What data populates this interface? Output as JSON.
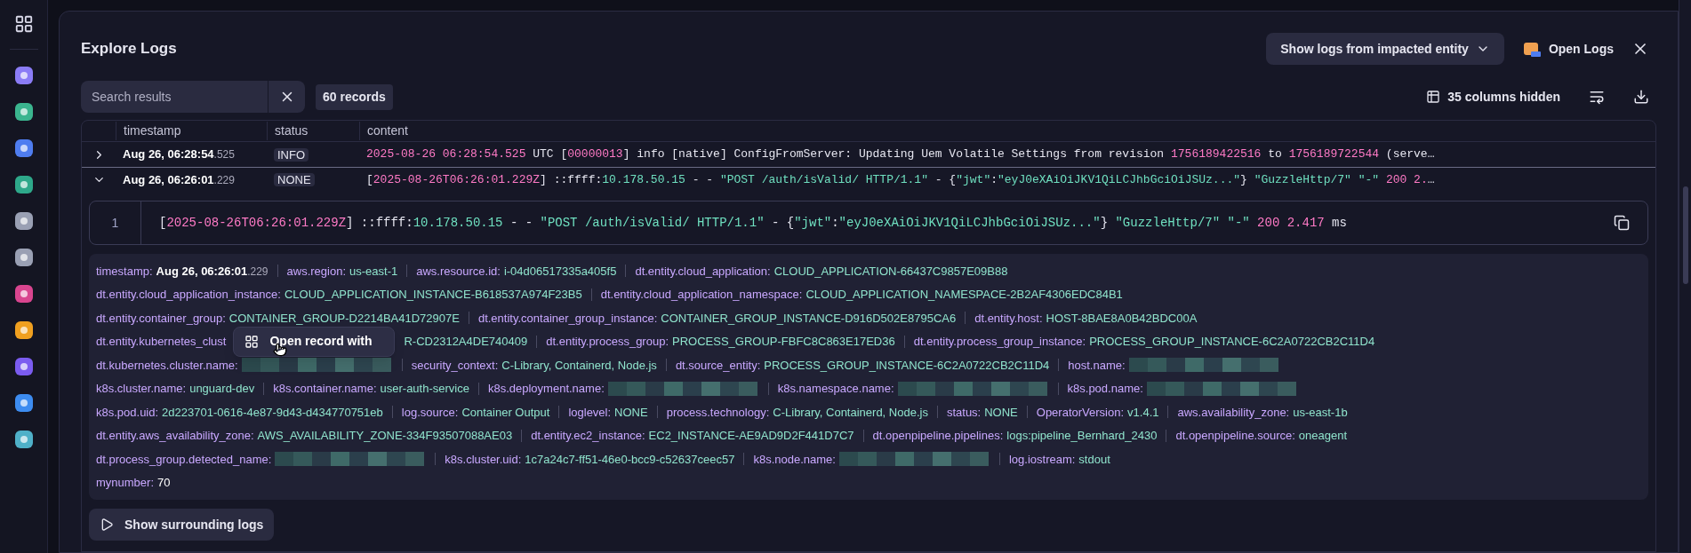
{
  "title": "Explore Logs",
  "entity_dropdown": "Show logs from impacted entity",
  "open_logs": "Open Logs",
  "search": {
    "placeholder": "Search results"
  },
  "record_count": "60 records",
  "columns_hidden": "35 columns hidden",
  "table": {
    "columns": [
      "timestamp",
      "status",
      "content"
    ],
    "rows": [
      {
        "expanded": false,
        "time": "Aug 26, 06:28:54",
        "ms": ".525",
        "status": "INFO",
        "content": [
          {
            "text": "2025-08-26 06:28:54.525",
            "kind": "num"
          },
          {
            "text": " UTC [",
            "kind": "plain"
          },
          {
            "text": "00000013",
            "kind": "num"
          },
          {
            "text": "] info [native] ConfigFromServer: Updating Uem Volatile Settings from revision ",
            "kind": "plain"
          },
          {
            "text": "1756189422516",
            "kind": "num"
          },
          {
            "text": " to ",
            "kind": "plain"
          },
          {
            "text": "1756189722544",
            "kind": "num"
          },
          {
            "text": " (serve…",
            "kind": "plain"
          }
        ]
      },
      {
        "expanded": true,
        "time": "Aug 26, 06:26:01",
        "ms": ".229",
        "status": "NONE",
        "content": [
          {
            "text": "[",
            "kind": "plain"
          },
          {
            "text": "2025-08-26T06:26:01.229Z",
            "kind": "num"
          },
          {
            "text": "] ::ffff:",
            "kind": "plain"
          },
          {
            "text": "10.178.50.15",
            "kind": "str"
          },
          {
            "text": " - - ",
            "kind": "plain"
          },
          {
            "text": "\"POST /auth/isValid/ HTTP/1.1\"",
            "kind": "str"
          },
          {
            "text": " - {",
            "kind": "plain"
          },
          {
            "text": "\"jwt\"",
            "kind": "str"
          },
          {
            "text": ":",
            "kind": "plain"
          },
          {
            "text": "\"eyJ0eXAiOiJKV1QiLCJhbGciOiJSUz...\"",
            "kind": "str"
          },
          {
            "text": "} ",
            "kind": "plain"
          },
          {
            "text": "\"GuzzleHttp/7\"",
            "kind": "str"
          },
          {
            "text": " \"-\"",
            "kind": "str"
          },
          {
            "text": " 200 2.",
            "kind": "num"
          },
          {
            "text": "…",
            "kind": "plain"
          }
        ]
      }
    ]
  },
  "detail": {
    "line_number": "1",
    "content": [
      {
        "text": "[",
        "kind": "plain"
      },
      {
        "text": "2025-08-26T06:26:01.229Z",
        "kind": "num"
      },
      {
        "text": "] ::ffff:",
        "kind": "plain"
      },
      {
        "text": "10.178.50.15",
        "kind": "str"
      },
      {
        "text": " - - ",
        "kind": "plain"
      },
      {
        "text": "\"POST /auth/isValid/ HTTP/1.1\"",
        "kind": "str"
      },
      {
        "text": " - {",
        "kind": "plain"
      },
      {
        "text": "\"jwt\"",
        "kind": "str"
      },
      {
        "text": ":",
        "kind": "plain"
      },
      {
        "text": "\"eyJ0eXAiOiJKV1QiLCJhbGciOiJSUz...\"",
        "kind": "str"
      },
      {
        "text": "} ",
        "kind": "plain"
      },
      {
        "text": "\"GuzzleHttp/7\"",
        "kind": "str"
      },
      {
        "text": " \"-\"",
        "kind": "str"
      },
      {
        "text": " 200 2.417",
        "kind": "num"
      },
      {
        "text": " ms",
        "kind": "plain"
      }
    ]
  },
  "popup": {
    "label": "Open record with"
  },
  "attributes": [
    [
      {
        "kind": "time",
        "key": "timestamp:",
        "value": "Aug 26, 06:26:01",
        "ms": ".229"
      },
      {
        "kind": "text",
        "key": "aws.region:",
        "value": "us-east-1"
      },
      {
        "kind": "text",
        "key": "aws.resource.id:",
        "value": "i-04d06517335a405f5"
      },
      {
        "kind": "text",
        "key": "dt.entity.cloud_application:",
        "value": "CLOUD_APPLICATION-66437C9857E09B88"
      }
    ],
    [
      {
        "kind": "text",
        "key": "dt.entity.cloud_application_instance:",
        "value": "CLOUD_APPLICATION_INSTANCE-B618537A974F23B5"
      },
      {
        "kind": "text",
        "key": "dt.entity.cloud_application_namespace:",
        "value": "CLOUD_APPLICATION_NAMESPACE-2B2AF4306EDC84B1"
      }
    ],
    [
      {
        "kind": "text",
        "key": "dt.entity.container_group:",
        "value": "CONTAINER_GROUP-D2214BA41D72907E"
      },
      {
        "kind": "text",
        "key": "dt.entity.container_group_instance:",
        "value": "CONTAINER_GROUP_INSTANCE-D916D502E8795CA6"
      },
      {
        "kind": "text",
        "key": "dt.entity.host:",
        "value": "HOST-8BAE8A0B42BDC00A"
      }
    ],
    [
      {
        "kind": "covered",
        "key": "dt.entity.kubernetes_clust",
        "value": "R-CD2312A4DE740409"
      },
      {
        "kind": "text",
        "key": "dt.entity.process_group:",
        "value": "PROCESS_GROUP-FBFC8C863E17ED36"
      },
      {
        "kind": "text",
        "key": "dt.entity.process_group_instance:",
        "value": "PROCESS_GROUP_INSTANCE-6C2A0722CB2C11D4"
      }
    ],
    [
      {
        "kind": "redacted",
        "key": "dt.kubernetes.cluster.name:"
      },
      {
        "kind": "text",
        "key": "security_context:",
        "value": "C-Library, Containerd, Node.js"
      },
      {
        "kind": "text",
        "key": "dt.source_entity:",
        "value": "PROCESS_GROUP_INSTANCE-6C2A0722CB2C11D4"
      },
      {
        "kind": "redacted",
        "key": "host.name:"
      }
    ],
    [
      {
        "kind": "text",
        "key": "k8s.cluster.name:",
        "value": "unguard-dev"
      },
      {
        "kind": "text",
        "key": "k8s.container.name:",
        "value": "user-auth-service"
      },
      {
        "kind": "redacted",
        "key": "k8s.deployment.name:"
      },
      {
        "kind": "redacted",
        "key": "k8s.namespace.name:"
      },
      {
        "kind": "redacted",
        "key": "k8s.pod.name:"
      }
    ],
    [
      {
        "kind": "text",
        "key": "k8s.pod.uid:",
        "value": "2d223701-0616-4e87-9d43-d434770751eb"
      },
      {
        "kind": "text",
        "key": "log.source:",
        "value": "Container Output"
      },
      {
        "kind": "text",
        "key": "loglevel:",
        "value": "NONE"
      },
      {
        "kind": "text",
        "key": "process.technology:",
        "value": "C-Library, Containerd, Node.js"
      },
      {
        "kind": "text",
        "key": "status:",
        "value": "NONE"
      },
      {
        "kind": "text",
        "key": "OperatorVersion:",
        "value": "v1.4.1"
      },
      {
        "kind": "text",
        "key": "aws.availability_zone:",
        "value": "us-east-1b"
      }
    ],
    [
      {
        "kind": "text",
        "key": "dt.entity.aws_availability_zone:",
        "value": "AWS_AVAILABILITY_ZONE-334F93507088AE03"
      },
      {
        "kind": "text",
        "key": "dt.entity.ec2_instance:",
        "value": "EC2_INSTANCE-AE9AD9D2F441D7C7"
      },
      {
        "kind": "text",
        "key": "dt.openpipeline.pipelines:",
        "value": "logs:pipeline_Bernhard_2430"
      },
      {
        "kind": "text",
        "key": "dt.openpipeline.source:",
        "value": "oneagent"
      }
    ],
    [
      {
        "kind": "redacted",
        "key": "dt.process_group.detected_name:"
      },
      {
        "kind": "text",
        "key": "k8s.cluster.uid:",
        "value": "1c7a24c7-ff51-46e0-bcc9-c52637ceec57"
      },
      {
        "kind": "redacted",
        "key": "k8s.node.name:"
      },
      {
        "kind": "text",
        "key": "log.iostream:",
        "value": "stdout"
      }
    ],
    [
      {
        "kind": "number",
        "key": "mynumber:",
        "value": "70"
      }
    ]
  ],
  "surrounding_button": "Show surrounding logs"
}
